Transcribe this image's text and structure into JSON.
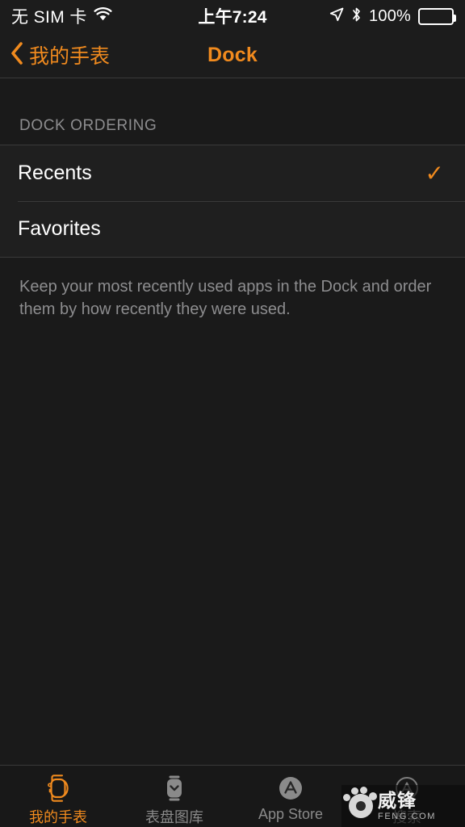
{
  "status_bar": {
    "carrier": "无 SIM 卡",
    "wifi_icon": "wifi-icon",
    "time": "上午7:24",
    "location_icon": "location-arrow-icon",
    "bluetooth_icon": "bluetooth-icon",
    "battery_percent": "100%",
    "battery_icon": "battery-full-icon"
  },
  "nav_bar": {
    "back_icon": "chevron-left-icon",
    "back_label": "我的手表",
    "title": "Dock",
    "accent_color": "#f08a1e"
  },
  "main": {
    "section_header": "DOCK ORDERING",
    "rows": [
      {
        "label": "Recents",
        "checked": true,
        "check_glyph": "✓"
      },
      {
        "label": "Favorites",
        "checked": false,
        "check_glyph": "✓"
      }
    ],
    "footer_note": "Keep your most recently used apps in the Dock and order them by how recently they were used."
  },
  "tab_bar": {
    "tabs": [
      {
        "label": "我的手表",
        "icon": "apple-watch-icon",
        "active": true
      },
      {
        "label": "表盘图库",
        "icon": "watch-face-gallery-icon",
        "active": false
      },
      {
        "label": "App Store",
        "icon": "app-store-icon",
        "active": false
      },
      {
        "label": "搜索",
        "icon": "app-store-search-icon",
        "active": false
      }
    ]
  },
  "watermark": {
    "logo_icon": "feng-paw-logo-icon",
    "title": "威锋",
    "subtitle": "FENG.COM"
  }
}
